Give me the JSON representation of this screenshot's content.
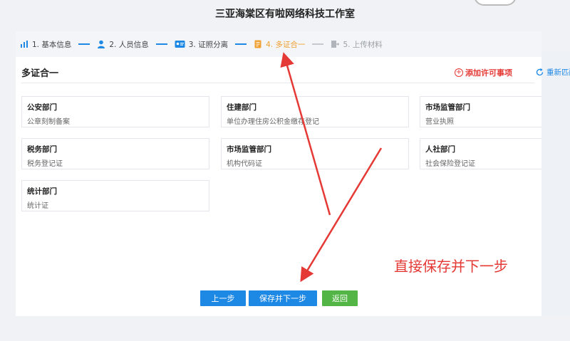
{
  "company_title": "三亚海棠区有啦网络科技工作室",
  "steps": [
    {
      "label": "1. 基本信息",
      "state": "done",
      "icon": "bar-chart-icon"
    },
    {
      "label": "2. 人员信息",
      "state": "done",
      "icon": "person-icon"
    },
    {
      "label": "3. 证照分离",
      "state": "done",
      "icon": "id-card-icon"
    },
    {
      "label": "4. 多证合一",
      "state": "active",
      "icon": "document-icon"
    },
    {
      "label": "5. 上传材料",
      "state": "pending",
      "icon": "upload-icon"
    }
  ],
  "section_title": "多证合一",
  "add_license_label": "添加许可事项",
  "reselect_label": "重新匹配",
  "cards": [
    {
      "dept": "公安部门",
      "cert": "公章刻制备案"
    },
    {
      "dept": "住建部门",
      "cert": "单位办理住房公积金缴存登记"
    },
    {
      "dept": "市场监管部门",
      "cert": "营业执照"
    },
    {
      "dept": "税务部门",
      "cert": "税务登记证"
    },
    {
      "dept": "市场监管部门",
      "cert": "机构代码证"
    },
    {
      "dept": "人社部门",
      "cert": "社会保险登记证"
    },
    {
      "dept": "统计部门",
      "cert": "统计证"
    }
  ],
  "buttons": {
    "prev": "上一步",
    "save_next": "保存并下一步",
    "back": "返回"
  },
  "annotation_text": "直接保存并下一步",
  "colors": {
    "primary": "#1e88e5",
    "active_step": "#f0a030",
    "annotation": "#e53935",
    "back_button": "#52b545"
  }
}
